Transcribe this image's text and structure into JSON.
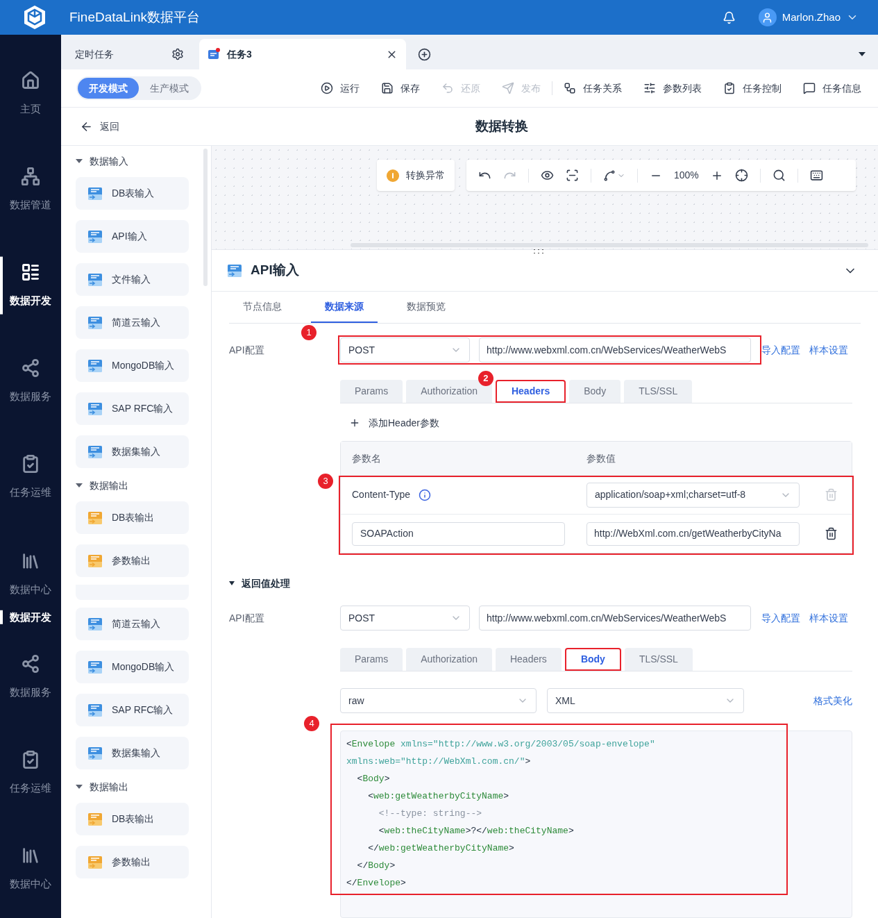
{
  "header": {
    "title": "FineDataLink数据平台",
    "user": "Marlon.Zhao"
  },
  "nav": [
    {
      "label": "主页",
      "kind": "home",
      "selected": false
    },
    {
      "label": "数据管道",
      "kind": "pipeline",
      "selected": false
    },
    {
      "label": "数据开发",
      "kind": "develop",
      "selected": true
    },
    {
      "label": "数据服务",
      "kind": "service",
      "selected": false
    },
    {
      "label": "任务运维",
      "kind": "ops",
      "selected": false
    },
    {
      "label": "数据中心",
      "kind": "center",
      "selected": false
    },
    {
      "label": "数据开发",
      "kind": "label",
      "selected": true
    },
    {
      "label": "数据服务",
      "kind": "service",
      "selected": false
    },
    {
      "label": "任务运维",
      "kind": "ops",
      "selected": false
    },
    {
      "label": "数据中心",
      "kind": "center",
      "selected": false
    }
  ],
  "tabs": [
    {
      "label": "定时任务",
      "kind": "pinned",
      "selected": false
    },
    {
      "label": "任务3",
      "kind": "task",
      "selected": true
    }
  ],
  "modes": [
    {
      "label": "开发模式",
      "selected": true
    },
    {
      "label": "生产模式",
      "selected": false
    }
  ],
  "actions": [
    {
      "label": "运行",
      "kind": "run",
      "disabled": false
    },
    {
      "label": "保存",
      "kind": "save",
      "disabled": false
    },
    {
      "label": "还原",
      "kind": "revert",
      "disabled": true
    },
    {
      "label": "发布",
      "kind": "publish",
      "disabled": true
    },
    {
      "label": "任务关系",
      "kind": "relation",
      "disabled": false
    },
    {
      "label": "参数列表",
      "kind": "params",
      "disabled": false
    },
    {
      "label": "任务控制",
      "kind": "control",
      "disabled": false
    },
    {
      "label": "任务信息",
      "kind": "info",
      "disabled": false
    }
  ],
  "page": {
    "back": "返回",
    "title": "数据转换"
  },
  "palette": [
    {
      "label": "数据输入",
      "kind": "group",
      "expanded": true
    },
    {
      "label": "DB表输入",
      "kind": "db"
    },
    {
      "label": "API输入",
      "kind": "api"
    },
    {
      "label": "文件输入",
      "kind": "file"
    },
    {
      "label": "简道云输入",
      "kind": "jdy"
    },
    {
      "label": "MongoDB输入",
      "kind": "mongo"
    },
    {
      "label": "SAP RFC输入",
      "kind": "sap"
    },
    {
      "label": "数据集输入",
      "kind": "dataset"
    },
    {
      "label": "数据输出",
      "kind": "group",
      "expanded": true
    },
    {
      "label": "DB表输出",
      "kind": "db_out"
    },
    {
      "label": "参数输出",
      "kind": "param_out"
    },
    {
      "kind": "cut"
    },
    {
      "label": "简道云输入",
      "kind": "jdy"
    },
    {
      "label": "MongoDB输入",
      "kind": "mongo"
    },
    {
      "label": "SAP RFC输入",
      "kind": "sap"
    },
    {
      "label": "数据集输入",
      "kind": "dataset"
    },
    {
      "label": "数据输出",
      "kind": "group",
      "expanded": true
    },
    {
      "label": "DB表输出",
      "kind": "db_out"
    },
    {
      "label": "参数输出",
      "kind": "param_out"
    }
  ],
  "canvas": {
    "status": "转换异常",
    "zoom": "100%"
  },
  "panel": {
    "title": "API输入",
    "expanded": true,
    "tabs": [
      {
        "label": "节点信息",
        "selected": false
      },
      {
        "label": "数据来源",
        "selected": true
      },
      {
        "label": "数据预览",
        "selected": false
      }
    ],
    "request": {
      "label": "API配置",
      "method": "POST",
      "url": "http://www.webxml.com.cn/WebServices/WeatherWebS",
      "links": [
        "导入配置",
        "样本设置"
      ],
      "callout": "1",
      "subtabs": [
        {
          "label": "Params",
          "selected": false
        },
        {
          "label": "Authorization",
          "selected": false
        },
        {
          "label": "Headers",
          "selected": true,
          "boxed": true,
          "callout": "2"
        },
        {
          "label": "Body",
          "selected": false
        },
        {
          "label": "TLS/SSL",
          "selected": false
        }
      ]
    },
    "headers": {
      "add": "添加Header参数",
      "columns": [
        "参数名",
        "参数值"
      ],
      "callout": "3",
      "rows": [
        {
          "kind": "fixed",
          "name": "Content-Type",
          "value": "application/soap+xml;charset=utf-8",
          "deletable": false
        },
        {
          "kind": "custom",
          "name": "SOAPAction",
          "value": "http://WebXml.com.cn/getWeatherbyCityNa",
          "deletable": true
        }
      ]
    },
    "response": {
      "label": "返回值处理",
      "expanded": true
    },
    "request2": {
      "label": "API配置",
      "method": "POST",
      "url": "http://www.webxml.com.cn/WebServices/WeatherWebS",
      "links": [
        "导入配置",
        "样本设置"
      ],
      "subtabs": [
        {
          "label": "Params",
          "selected": false
        },
        {
          "label": "Authorization",
          "selected": false
        },
        {
          "label": "Headers",
          "selected": false
        },
        {
          "label": "Body",
          "selected": true,
          "boxed": true
        },
        {
          "label": "TLS/SSL",
          "selected": false
        }
      ]
    },
    "body": {
      "mode": "raw",
      "type": "XML",
      "link": "格式美化",
      "callout": "4",
      "lines": [
        [
          {
            "kind": "punct",
            "t": "<"
          },
          {
            "kind": "tag",
            "t": "Envelope"
          },
          {
            "kind": "attr",
            "t": " xmlns=\"http://www.w3.org/2003/05/soap-envelope\""
          }
        ],
        [
          {
            "kind": "attr",
            "t": "xmlns:web=\"http://WebXml.com.cn/\""
          },
          {
            "kind": "punct",
            "t": ">"
          }
        ],
        [
          {
            "kind": "punct",
            "t": "  <"
          },
          {
            "kind": "tag",
            "t": "Body"
          },
          {
            "kind": "punct",
            "t": ">"
          }
        ],
        [
          {
            "kind": "punct",
            "t": "    <"
          },
          {
            "kind": "tag",
            "t": "web:getWeatherbyCityName"
          },
          {
            "kind": "punct",
            "t": ">"
          }
        ],
        [
          {
            "kind": "comment",
            "t": "      <!--type: string-->"
          }
        ],
        [
          {
            "kind": "punct",
            "t": "      <"
          },
          {
            "kind": "tag",
            "t": "web:theCityName"
          },
          {
            "kind": "punct",
            "t": ">?</"
          },
          {
            "kind": "tag",
            "t": "web:theCityName"
          },
          {
            "kind": "punct",
            "t": ">"
          }
        ],
        [
          {
            "kind": "punct",
            "t": "    </"
          },
          {
            "kind": "tag",
            "t": "web:getWeatherbyCityName"
          },
          {
            "kind": "punct",
            "t": ">"
          }
        ],
        [
          {
            "kind": "punct",
            "t": "  </"
          },
          {
            "kind": "tag",
            "t": "Body"
          },
          {
            "kind": "punct",
            "t": ">"
          }
        ],
        [
          {
            "kind": "punct",
            "t": "</"
          },
          {
            "kind": "tag",
            "t": "Envelope"
          },
          {
            "kind": "punct",
            "t": ">"
          }
        ]
      ]
    }
  }
}
